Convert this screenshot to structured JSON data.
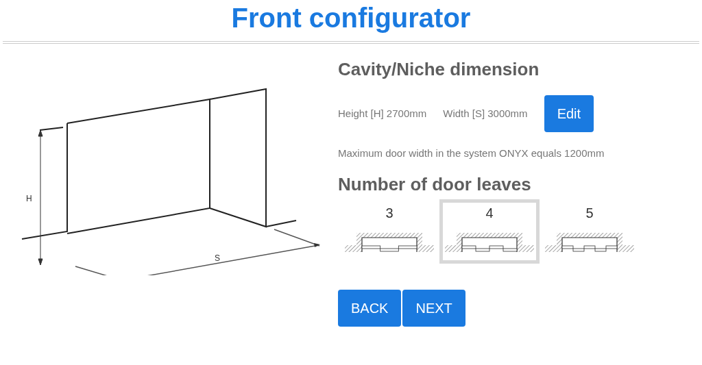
{
  "title": "Front configurator",
  "niche": {
    "heading": "Cavity/Niche dimension",
    "height": "Height [H] 2700mm",
    "width": "Width [S] 3000mm",
    "edit_button": "Edit",
    "note": "Maximum door width in the system ONYX equals 1200mm"
  },
  "drawing": {
    "height_label": "H",
    "width_label": "S"
  },
  "leaves": {
    "heading": "Number of door leaves",
    "options": [
      {
        "label": "3",
        "selected": false
      },
      {
        "label": "4",
        "selected": true
      },
      {
        "label": "5",
        "selected": false
      }
    ]
  },
  "buttons": [
    "BACK",
    "NEXT"
  ]
}
